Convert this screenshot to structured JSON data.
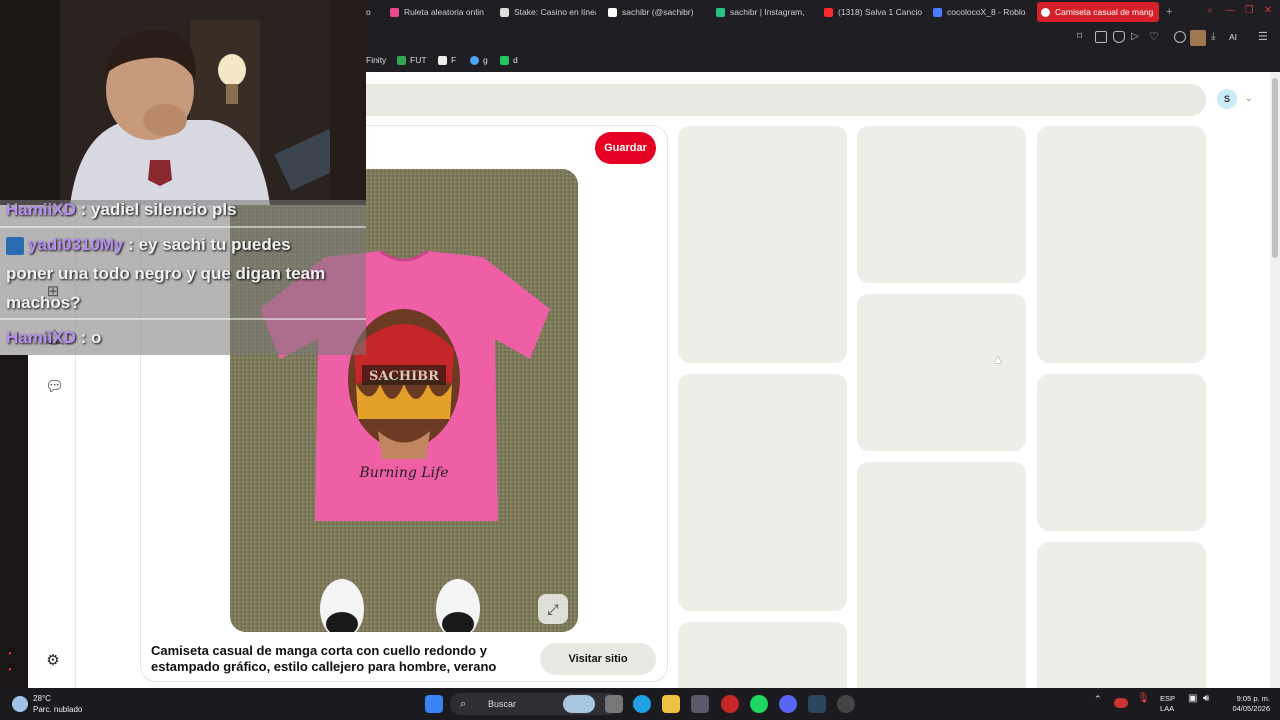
{
  "browser": {
    "tabs": [
      {
        "label": "o",
        "color": "#888888"
      },
      {
        "label": "Ruleta aleatoria onlin",
        "color": "#e84a8f"
      },
      {
        "label": "Stake: Casino en línea",
        "color": "#dddddd"
      },
      {
        "label": "sachibr (@sachibr)",
        "color": "#ffffff"
      },
      {
        "label": "sachibr | Instagram,",
        "color": "#26c281"
      },
      {
        "label": "(1318) Salva 1 Cancio",
        "color": "#ff2b2b"
      },
      {
        "label": "cocolocoX_8 - Roblo",
        "color": "#4a7cff"
      },
      {
        "label": "Camiseta casual de mang",
        "color": "#ffffff"
      }
    ],
    "new_tab": "+",
    "extension_label": "AI",
    "bookmarks": [
      {
        "label": "Finity",
        "color": "#888888"
      },
      {
        "label": "FUT",
        "color": "#32a852"
      },
      {
        "label": "F",
        "color": "#eeeeee"
      },
      {
        "label": "g",
        "color": "#4fa3f7"
      },
      {
        "label": "d",
        "color": "#22c55e"
      }
    ]
  },
  "header": {
    "avatar_initial": "S",
    "dropdown_icon": "chevron-down-icon"
  },
  "pin": {
    "save_label": "Guardar",
    "title": "Camiseta casual de manga corta con cuello redondo y estampado gráfico, estilo callejero para hombre, verano",
    "visit_label": "Visitar sitio",
    "image_text": "Burning Life",
    "expand_icon": "expand-icon"
  },
  "rail": {
    "icons": [
      "add-icon",
      "bell-icon",
      "chat-icon",
      "settings-icon"
    ]
  },
  "chat": {
    "messages": [
      {
        "user": "HamiiXD",
        "text": ": yadiel silencio pls"
      },
      {
        "user": "yadi0310My",
        "text": ": ey sachi tu puedes"
      },
      {
        "user": "",
        "text": "poner una todo negro y que digan team"
      },
      {
        "user": "",
        "text": "machos?"
      },
      {
        "user": "HamiiXD",
        "text": ": o"
      }
    ]
  },
  "taskbar": {
    "weather_temp": "28°C",
    "weather_desc": "Parc. nublado",
    "search_label": "Buscar",
    "lang": "ESP",
    "lang_sub": "LAA",
    "time": "9:05 p. m.",
    "date": "04/05/2026"
  },
  "colors": {
    "accent_red": "#e60023",
    "placeholder": "#eeede8",
    "chrome": "#1f1f23"
  }
}
